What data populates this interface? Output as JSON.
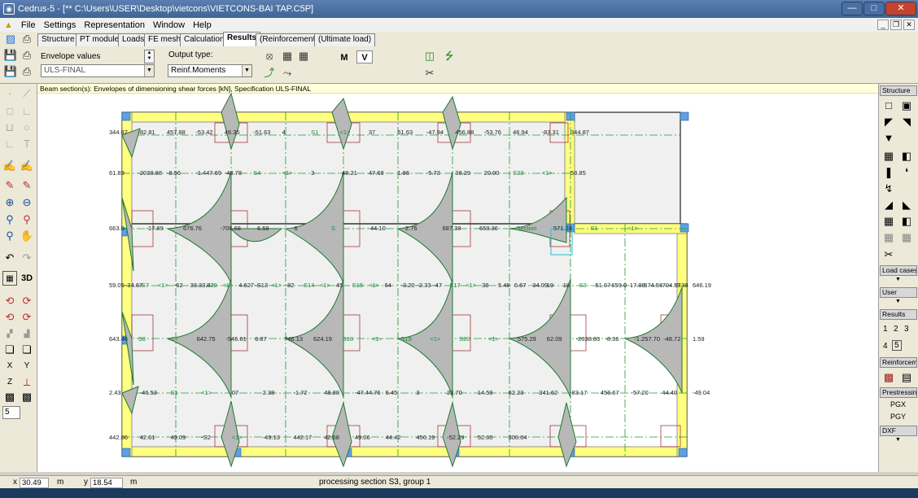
{
  "window": {
    "title": "Cedrus-5 - [** C:\\Users\\USER\\Desktop\\vietcons\\VIETCONS-BAI TAP.C5P]"
  },
  "menu": [
    "File",
    "Settings",
    "Representation",
    "Window",
    "Help"
  ],
  "tabs": [
    "Structure",
    "PT module",
    "Loads",
    "FE mesh",
    "Calculation",
    "Results",
    "(Reinforcement)",
    "(Ultimate load)"
  ],
  "toolbar": {
    "envelope_label": "Envelope values",
    "envelope_value": "ULS-FINAL",
    "output_label": "Output type:",
    "output_value": "Reinf.Moments",
    "m_label": "M",
    "v_label": "V"
  },
  "caption": "Beam section(s): Envelopes of dimensioning shear forces  [kN],  Specification ULS-FINAL",
  "right_palette": {
    "structure": "Structure",
    "load_cases": "Load cases",
    "user": "User",
    "results": "Results",
    "results_nums": [
      "1",
      "2",
      "3",
      "4",
      "5"
    ],
    "reinforcement": "Reinforcem",
    "prestressing": "Prestressin",
    "pgx": "PGX",
    "pgy": "PGY",
    "dxf": "DXF"
  },
  "left_palette": {
    "step_value": "5",
    "mode_3d": "3D"
  },
  "status": {
    "x_label": "x",
    "x_value": "30.49",
    "x_unit": "m",
    "y_label": "y",
    "y_value": "18.54",
    "y_unit": "m",
    "message": "processing section S3, group 1"
  },
  "drawing": {
    "row_labels": [
      "344.87",
      "-82.81",
      "457.88",
      "-53.42",
      "46.35",
      "-51.63",
      "4",
      "S1",
      "<1>",
      "37",
      "51.63",
      "-47.94",
      "456.88",
      "-53.76",
      "46.94",
      "-83.31",
      "344.87",
      "61.89",
      "-2038.88",
      "-8.56",
      "-1.447.69",
      "-48.78",
      "S4",
      "<1>",
      "3",
      "-48.21",
      "47.68",
      "1.86",
      "-5.73",
      "38.29",
      "20.00",
      "S23",
      "<1>",
      "58.85",
      "663.0",
      "-17.89",
      "676.76",
      "-706.68",
      "6.58",
      "6",
      "S",
      "-44.10",
      "2.76",
      "687.38",
      "668.36",
      "Section",
      "571.24",
      "S1",
      "<1>",
      "59.05",
      "-34.67",
      "S7",
      "<1>",
      "-62",
      "38.33.42",
      "S29",
      "<1>",
      "4.627",
      "-S13",
      "<1>",
      "82",
      "S14",
      "<1>",
      "45",
      "S15",
      "<1>",
      "64",
      "-3.20",
      "-2.33",
      "-47",
      "S17",
      "<1>",
      "38",
      "5.48",
      "6.67",
      "-34.09",
      "19",
      "18",
      "S3",
      "51.67",
      "659.0",
      "-17.88",
      "674.56",
      "-704.57",
      "6.38",
      "646.19",
      "643.46",
      "S8",
      "<1>",
      "642.75",
      "-546.61",
      "6.87",
      "746.13",
      "624.19",
      "S18",
      "<1>",
      "S19",
      "<1>",
      "S20",
      "<1>",
      "575.29",
      "62.09",
      "-2038.83",
      "-8.36",
      "-1.257.70",
      "-48.72",
      "1.59",
      "2.43",
      "-46.53",
      "S1",
      "<1>",
      "07",
      "2.38",
      "-1.72",
      "48.88",
      "-47.44.76",
      "6.45",
      "3",
      "23.70",
      "14.59",
      "62.23",
      "341.62",
      "-83.17",
      "456.67",
      "-57.20",
      "44.40",
      "-49.04",
      "442.86",
      "42.61",
      "49.09",
      "-S2",
      "<1>",
      "-49.13",
      "442.17",
      "42.68",
      "49.06",
      "44.42",
      "456.19",
      "-52.29",
      "52.60",
      "306.04"
    ]
  }
}
